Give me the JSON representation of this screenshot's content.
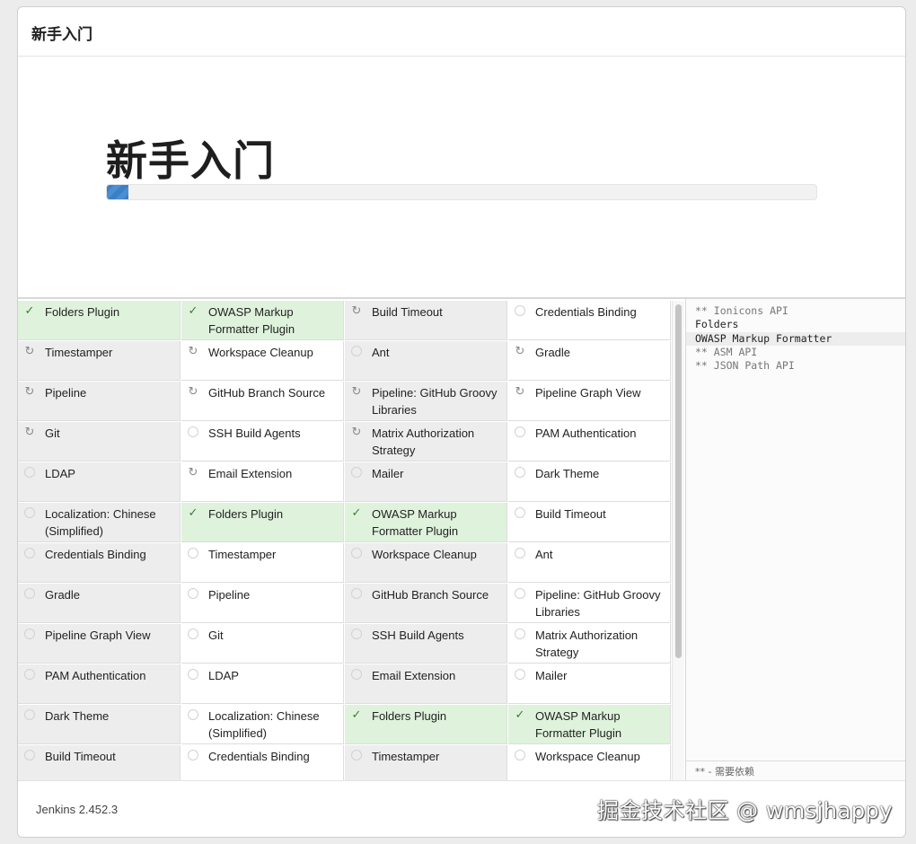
{
  "header": {
    "title": "新手入门"
  },
  "hero": {
    "title": "新手入门",
    "progress_percent": 3
  },
  "plugins": [
    [
      {
        "name": "Folders Plugin",
        "status": "success"
      },
      {
        "name": "OWASP Markup Formatter Plugin",
        "status": "success"
      },
      {
        "name": "Build Timeout",
        "status": "installing"
      },
      {
        "name": "Credentials Binding",
        "status": "pending"
      }
    ],
    [
      {
        "name": "Timestamper",
        "status": "installing"
      },
      {
        "name": "Workspace Cleanup",
        "status": "installing"
      },
      {
        "name": "Ant",
        "status": "pending"
      },
      {
        "name": "Gradle",
        "status": "installing"
      }
    ],
    [
      {
        "name": "Pipeline",
        "status": "installing"
      },
      {
        "name": "GitHub Branch Source",
        "status": "installing"
      },
      {
        "name": "Pipeline: GitHub Groovy Libraries",
        "status": "installing"
      },
      {
        "name": "Pipeline Graph View",
        "status": "installing"
      }
    ],
    [
      {
        "name": "Git",
        "status": "installing"
      },
      {
        "name": "SSH Build Agents",
        "status": "pending"
      },
      {
        "name": "Matrix Authorization Strategy",
        "status": "installing"
      },
      {
        "name": "PAM Authentication",
        "status": "pending"
      }
    ],
    [
      {
        "name": "LDAP",
        "status": "pending"
      },
      {
        "name": "Email Extension",
        "status": "installing"
      },
      {
        "name": "Mailer",
        "status": "pending"
      },
      {
        "name": "Dark Theme",
        "status": "pending"
      }
    ],
    [
      {
        "name": "Localization: Chinese (Simplified)",
        "status": "pending"
      },
      {
        "name": "Folders Plugin",
        "status": "success"
      },
      {
        "name": "OWASP Markup Formatter Plugin",
        "status": "success"
      },
      {
        "name": "Build Timeout",
        "status": "pending"
      }
    ],
    [
      {
        "name": "Credentials Binding",
        "status": "pending"
      },
      {
        "name": "Timestamper",
        "status": "pending"
      },
      {
        "name": "Workspace Cleanup",
        "status": "pending"
      },
      {
        "name": "Ant",
        "status": "pending"
      }
    ],
    [
      {
        "name": "Gradle",
        "status": "pending"
      },
      {
        "name": "Pipeline",
        "status": "pending"
      },
      {
        "name": "GitHub Branch Source",
        "status": "pending"
      },
      {
        "name": "Pipeline: GitHub Groovy Libraries",
        "status": "pending"
      }
    ],
    [
      {
        "name": "Pipeline Graph View",
        "status": "pending"
      },
      {
        "name": "Git",
        "status": "pending"
      },
      {
        "name": "SSH Build Agents",
        "status": "pending"
      },
      {
        "name": "Matrix Authorization Strategy",
        "status": "pending"
      }
    ],
    [
      {
        "name": "PAM Authentication",
        "status": "pending"
      },
      {
        "name": "LDAP",
        "status": "pending"
      },
      {
        "name": "Email Extension",
        "status": "pending"
      },
      {
        "name": "Mailer",
        "status": "pending"
      }
    ],
    [
      {
        "name": "Dark Theme",
        "status": "pending"
      },
      {
        "name": "Localization: Chinese (Simplified)",
        "status": "pending"
      },
      {
        "name": "Folders Plugin",
        "status": "success"
      },
      {
        "name": "OWASP Markup Formatter Plugin",
        "status": "success"
      }
    ],
    [
      {
        "name": "Build Timeout",
        "status": "pending"
      },
      {
        "name": "Credentials Binding",
        "status": "pending"
      },
      {
        "name": "Timestamper",
        "status": "pending"
      },
      {
        "name": "Workspace Cleanup",
        "status": "pending"
      }
    ]
  ],
  "log": {
    "lines": [
      {
        "text": "** Ionicons API",
        "type": "dep"
      },
      {
        "text": "Folders",
        "type": "normal"
      },
      {
        "text": "OWASP Markup Formatter",
        "type": "cur"
      },
      {
        "text": "** ASM API",
        "type": "dep"
      },
      {
        "text": "** JSON Path API",
        "type": "dep"
      }
    ],
    "legend": "** - 需要依赖"
  },
  "footer": {
    "version": "Jenkins 2.452.3",
    "watermark": "掘金技术社区 @ wmsjhappy"
  },
  "icons": {
    "success": "✓",
    "installing": "↻"
  }
}
